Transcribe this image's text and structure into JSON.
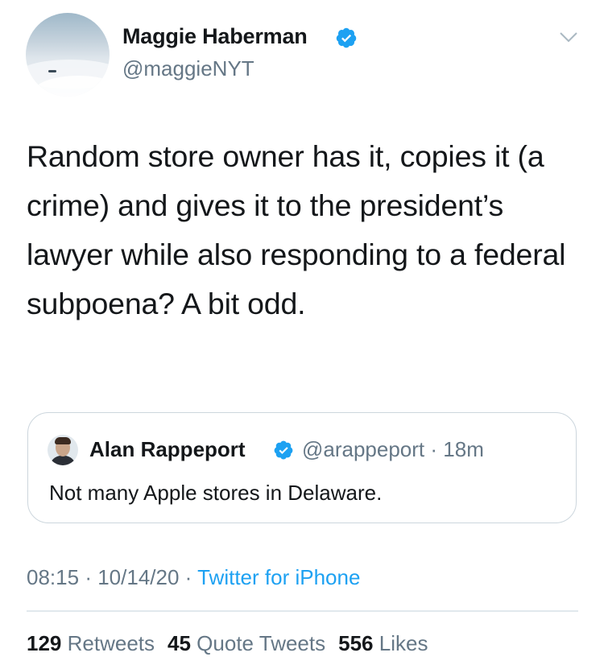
{
  "author": {
    "name": "Maggie Haberman",
    "handle": "@maggieNYT",
    "verified": true
  },
  "tweet": {
    "text": "Random store owner has it, copies it (a crime) and gives it to the president’s lawyer while also responding to a federal subpoena? A bit odd."
  },
  "quoted_tweet": {
    "author_name": "Alan Rappeport",
    "handle": "@arappeport",
    "time_ago": "18m",
    "text": "Not many Apple stores in Delaware."
  },
  "meta": {
    "time": "08:15",
    "date": "10/14/20",
    "source": "Twitter for iPhone",
    "separator": "·"
  },
  "stats": {
    "retweets": "129",
    "retweets_label": "Retweets",
    "quote_tweets": "45",
    "quote_tweets_label": "Quote Tweets",
    "likes": "556",
    "likes_label": "Likes"
  },
  "icons": {
    "verified": "verified-badge-icon",
    "menu": "chevron-down-icon"
  },
  "colors": {
    "accent": "#1da1f2",
    "secondary_text": "#657786",
    "primary_text": "#14171a",
    "border": "#ccd6dd"
  }
}
